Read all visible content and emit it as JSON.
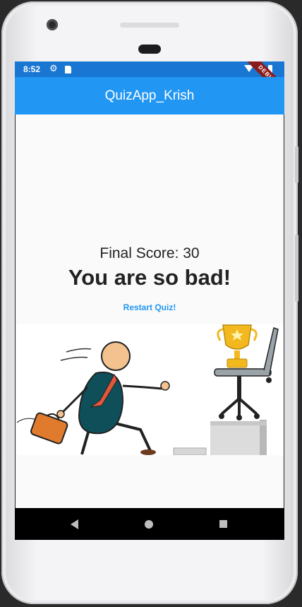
{
  "status_bar": {
    "time": "8:52",
    "icons": [
      "gear-icon",
      "sd-card-icon",
      "wifi-icon",
      "battery-icon"
    ],
    "debug_banner": "DEBUG"
  },
  "app_bar": {
    "title": "QuizApp_Krish"
  },
  "result": {
    "final_score": "Final Score: 30",
    "verdict": "You are so bad!",
    "restart_label": "Restart Quiz!"
  },
  "illustration": {
    "icon": "businessman-running-to-trophy-illustration"
  },
  "nav_bar": {
    "icons": [
      "back-icon",
      "home-icon",
      "recents-icon"
    ]
  },
  "colors": {
    "app_bar": "#2196f3",
    "status_bar": "#1976d2",
    "link": "#2196f3",
    "background": "#fafafa"
  }
}
